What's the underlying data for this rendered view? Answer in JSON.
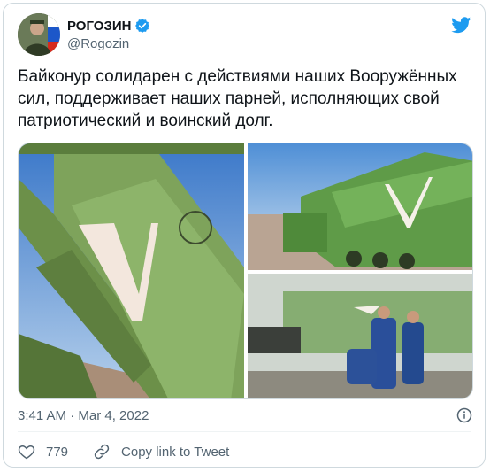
{
  "user": {
    "display_name": "РОГОЗИН",
    "handle": "@Rogozin"
  },
  "tweet": {
    "text": "Байконур солидарен с действиями наших Вооружённых сил, поддерживает наших парней, исполняющих свой патриотический и воинский долг.",
    "timestamp": "3:41 AM · Mar 4, 2022"
  },
  "actions": {
    "like_count": "779",
    "copy_link_label": "Copy link to Tweet"
  },
  "colors": {
    "twitter_blue": "#1d9bf0",
    "verified_blue": "#1d9bf0",
    "muted_text": "#536471"
  },
  "icons": [
    "verified-badge-icon",
    "twitter-bird-icon",
    "info-icon",
    "heart-icon",
    "link-icon"
  ]
}
